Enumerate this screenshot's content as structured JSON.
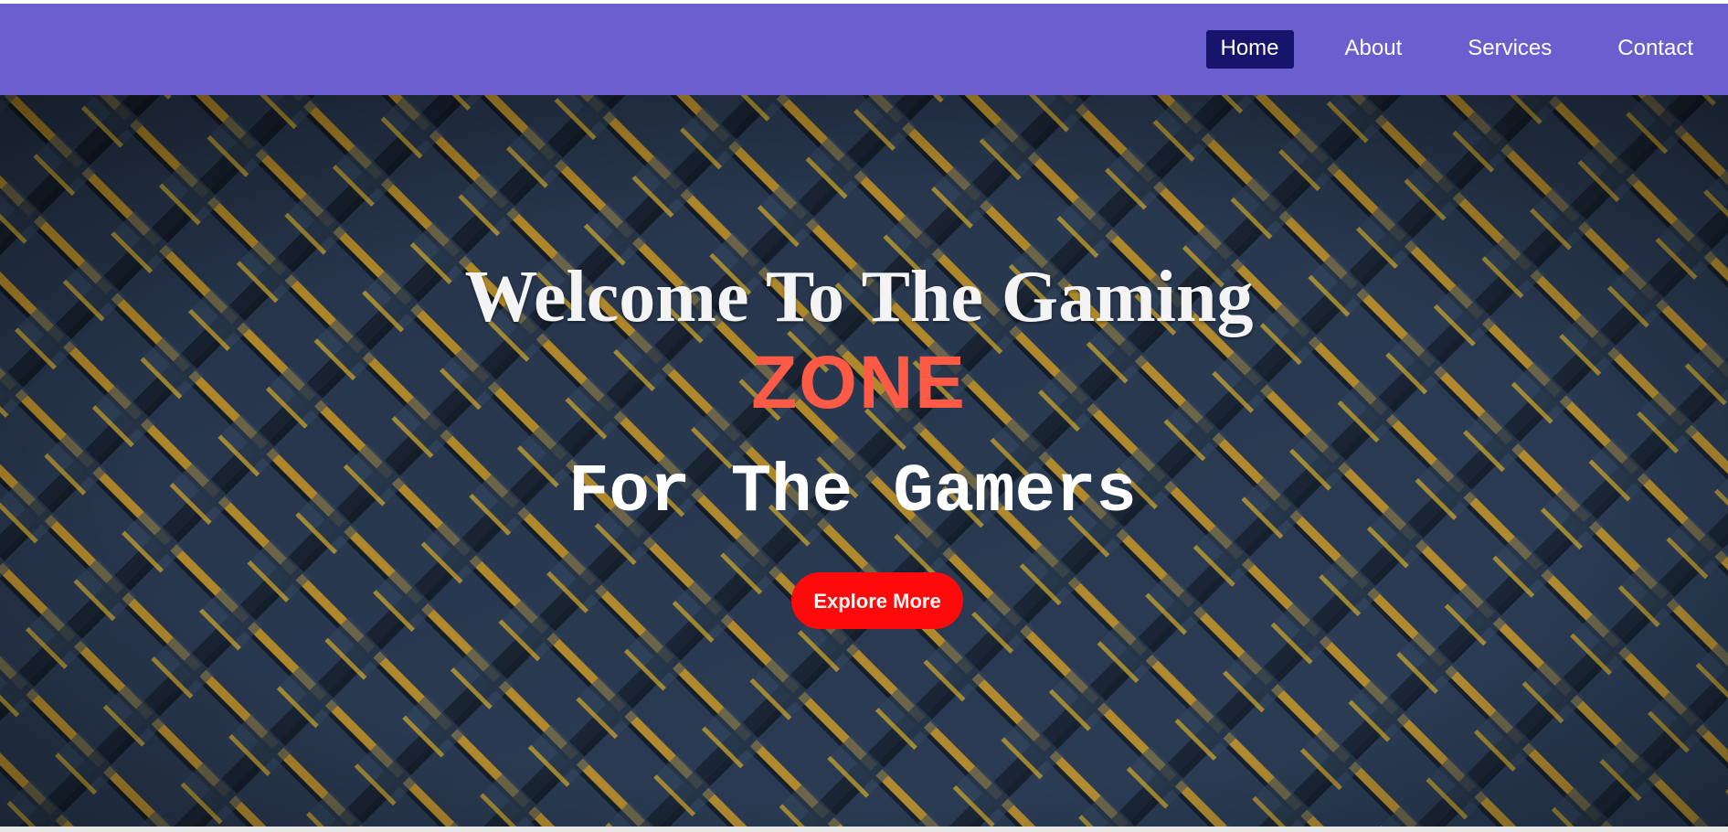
{
  "nav": {
    "items": [
      {
        "label": "Home",
        "active": true
      },
      {
        "label": "About",
        "active": false
      },
      {
        "label": "Services",
        "active": false
      },
      {
        "label": "Contact",
        "active": false
      }
    ]
  },
  "hero": {
    "title": "Welcome To The Gaming",
    "highlight": "ZONE",
    "subtitle": "For The Gamers",
    "cta_label": "Explore More"
  },
  "colors": {
    "navbar": "#6b5ecf",
    "active_nav": "#17146b",
    "highlight": "#ff5a45",
    "cta": "#ff0a0a"
  }
}
